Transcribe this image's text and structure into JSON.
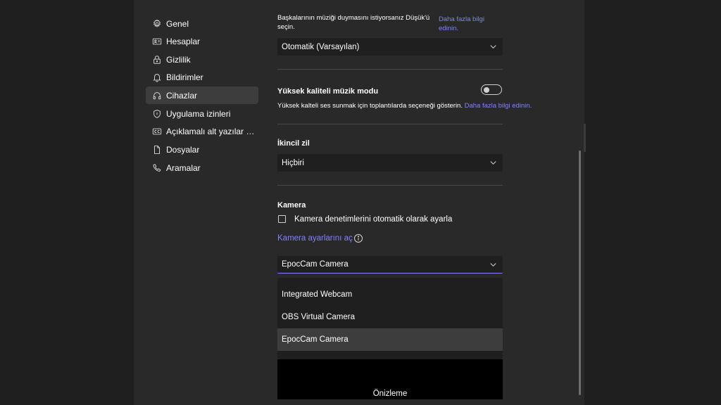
{
  "sidebar": {
    "items": [
      {
        "label": "Genel",
        "icon": "gear-icon"
      },
      {
        "label": "Hesaplar",
        "icon": "id-card-icon"
      },
      {
        "label": "Gizlilik",
        "icon": "lock-icon"
      },
      {
        "label": "Bildirimler",
        "icon": "bell-icon"
      },
      {
        "label": "Cihazlar",
        "icon": "headset-icon",
        "active": true
      },
      {
        "label": "Uygulama izinleri",
        "icon": "shield-icon"
      },
      {
        "label": "Açıklamalı alt yazılar ve ...",
        "icon": "cc-icon"
      },
      {
        "label": "Dosyalar",
        "icon": "file-icon"
      },
      {
        "label": "Aramalar",
        "icon": "phone-icon"
      }
    ]
  },
  "noise": {
    "text_line1": "Başkalarının müziği duymasını istiyorsanız Düşük'ü",
    "text_line2": "seçin.",
    "link_line1": "Daha fazla bilgi",
    "link_line2": "edinin.",
    "dropdown_value": "Otomatik (Varsayılan)"
  },
  "music_mode": {
    "title": "Yüksek kaliteli müzik modu",
    "description": "Yüksek kalteli ses sunmak için toplantılarda seçeneği gösterin.",
    "link": "Daha fazla bilgi edinin.",
    "enabled": false
  },
  "secondary_ringer": {
    "title": "İkincil zil",
    "dropdown_value": "Hiçbiri"
  },
  "camera": {
    "title": "Kamera",
    "auto_adjust_label": "Kamera denetimlerini otomatik olarak ayarla",
    "auto_adjust_checked": false,
    "open_settings_link": "Kamera ayarlarını aç",
    "dropdown_value": "EpocCam Camera",
    "options": [
      "Integrated Webcam",
      "OBS Virtual Camera",
      "EpocCam Camera"
    ],
    "selected_option": "EpocCam Camera",
    "preview_label": "Önizleme"
  },
  "colors": {
    "accent": "#7f85f5",
    "background": "#292929",
    "control": "#1f1f1f"
  }
}
